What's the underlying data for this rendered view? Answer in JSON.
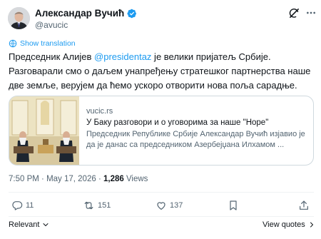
{
  "author": {
    "name": "Александар Вучић",
    "handle": "@avucic"
  },
  "translate": {
    "label": "Show translation"
  },
  "post": {
    "line1_before": "Председник Алијев ",
    "mention": "@presidentaz",
    "line1_after": " је велики пријатељ Србије.",
    "rest": "Разговарали смо о даљем унапређењу стратешког партнерства наше две земље, верујем да ћемо ускоро отворити нова поља сарадње."
  },
  "card": {
    "domain": "vucic.rs",
    "title": "У Баку разговори и о уговорима за наше \"Норе\"",
    "description": "Председник Републике Србије Александар Вучић изјавио је да је данас са председником Азербејџана Илхамом ..."
  },
  "meta": {
    "time": "7:50 PM",
    "separator1": " · ",
    "date": "May 17, 2026",
    "separator2": " · ",
    "views_count": "1,286",
    "views_label": " Views"
  },
  "actions": {
    "replies": "11",
    "reposts": "151",
    "likes": "137"
  },
  "footer": {
    "sort_label": "Relevant",
    "view_quotes_label": "View quotes"
  },
  "colors": {
    "accent": "#1d9bf0",
    "text": "#0f1419",
    "muted": "#536471",
    "border": "#cfd9de"
  },
  "icons": [
    "verified-badge-icon",
    "grok-icon",
    "more-icon",
    "translate-icon",
    "reply-icon",
    "repost-icon",
    "like-icon",
    "bookmark-icon",
    "share-icon",
    "chevron-down-icon",
    "chevron-right-icon"
  ]
}
